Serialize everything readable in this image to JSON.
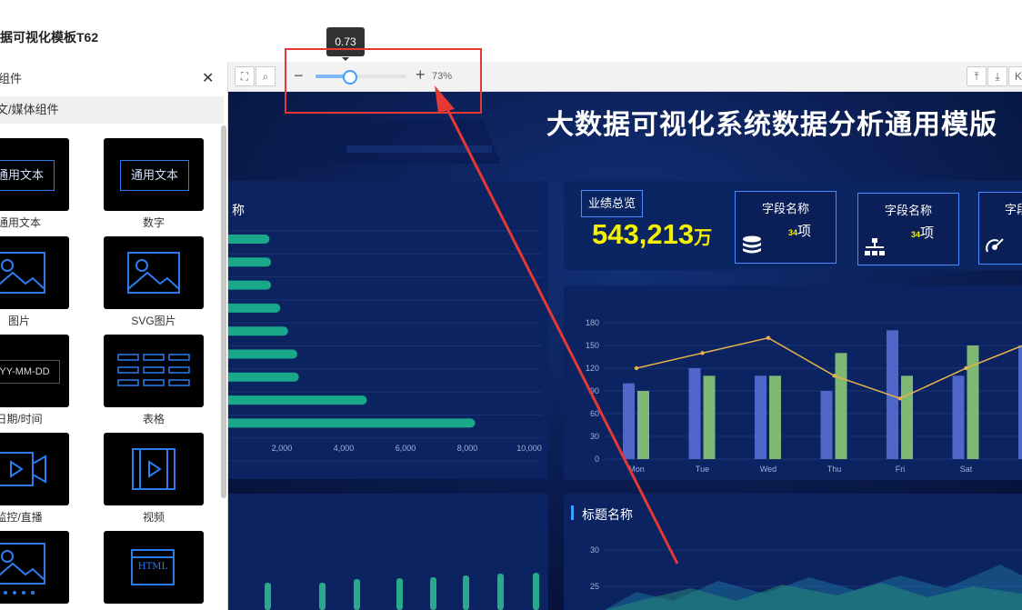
{
  "browser": {
    "bookmarks": [
      "",
      "",
      "",
      "",
      "",
      "",
      "",
      "",
      ""
    ]
  },
  "app": {
    "title": "据可视化模板T62"
  },
  "panel": {
    "header": "组件",
    "close_icon": "close-icon",
    "category": "文/媒体组件",
    "components": [
      {
        "label": "通用文本",
        "icon": "text-box-icon",
        "preview": "通用文本"
      },
      {
        "label": "数字",
        "icon": "text-box-icon",
        "preview": "通用文本"
      },
      {
        "label": "图片",
        "icon": "image-icon"
      },
      {
        "label": "SVG图片",
        "icon": "image-icon"
      },
      {
        "label": "日期/时间",
        "icon": "date-icon",
        "preview": "YY-MM-DD"
      },
      {
        "label": "表格",
        "icon": "table-icon"
      },
      {
        "label": "监控/直播",
        "icon": "camera-icon"
      },
      {
        "label": "视频",
        "icon": "video-icon"
      },
      {
        "label": "",
        "icon": "carousel-icon"
      },
      {
        "label": "",
        "icon": "html-icon",
        "preview": "HTML"
      }
    ]
  },
  "toolbar": {
    "fullscreen_icon": "fullscreen-icon",
    "search_icon": "search-icon",
    "zoom_minus": "−",
    "zoom_plus": "+",
    "zoom_percent": "73%",
    "zoom_value": 0.73,
    "tooltip": "0.73",
    "right_icons": [
      "align-top-icon",
      "align-bottom-icon",
      "expand-icon"
    ]
  },
  "dashboard": {
    "title": "大数据可视化系统数据分析通用模版",
    "left_card_title": "称",
    "kpi": {
      "title": "业绩总览",
      "value": "543,213",
      "unit": "万"
    },
    "fields": [
      {
        "name": "字段名称",
        "value": "项",
        "badge": "34",
        "icon": "database-icon"
      },
      {
        "name": "字段名称",
        "value": "项",
        "badge": "34",
        "icon": "org-chart-icon"
      },
      {
        "name": "字段",
        "value": "",
        "badge": "",
        "icon": "satellite-icon"
      }
    ],
    "bottom_right_title": "标题名称"
  },
  "chart_data": [
    {
      "type": "bar",
      "orientation": "horizontal",
      "x_ticks": [
        "2,000",
        "4,000",
        "6,000",
        "8,000",
        "10,000"
      ],
      "xlim": [
        0,
        10000
      ],
      "values": [
        1600,
        1650,
        1650,
        1950,
        2200,
        2500,
        2550,
        4750,
        8250
      ]
    },
    {
      "type": "bar",
      "categories": [
        "Mon",
        "Tue",
        "Wed",
        "Thu",
        "Fri",
        "Sat"
      ],
      "y_ticks": [
        "0",
        "30",
        "60",
        "90",
        "120",
        "150",
        "180"
      ],
      "ylim": [
        0,
        180
      ],
      "series": [
        {
          "values": [
            100,
            120,
            110,
            90,
            170,
            110
          ]
        },
        {
          "values": [
            90,
            110,
            110,
            140,
            110,
            150
          ]
        },
        {
          "type": "line",
          "values": [
            120,
            140,
            160,
            110,
            80,
            120
          ]
        }
      ],
      "colors": [
        "#4f67c9",
        "#7fb874",
        "#e8b24a"
      ]
    },
    {
      "type": "area",
      "y_ticks": [
        "25",
        "30"
      ]
    }
  ],
  "annotation": {
    "box_color": "#e53935"
  }
}
